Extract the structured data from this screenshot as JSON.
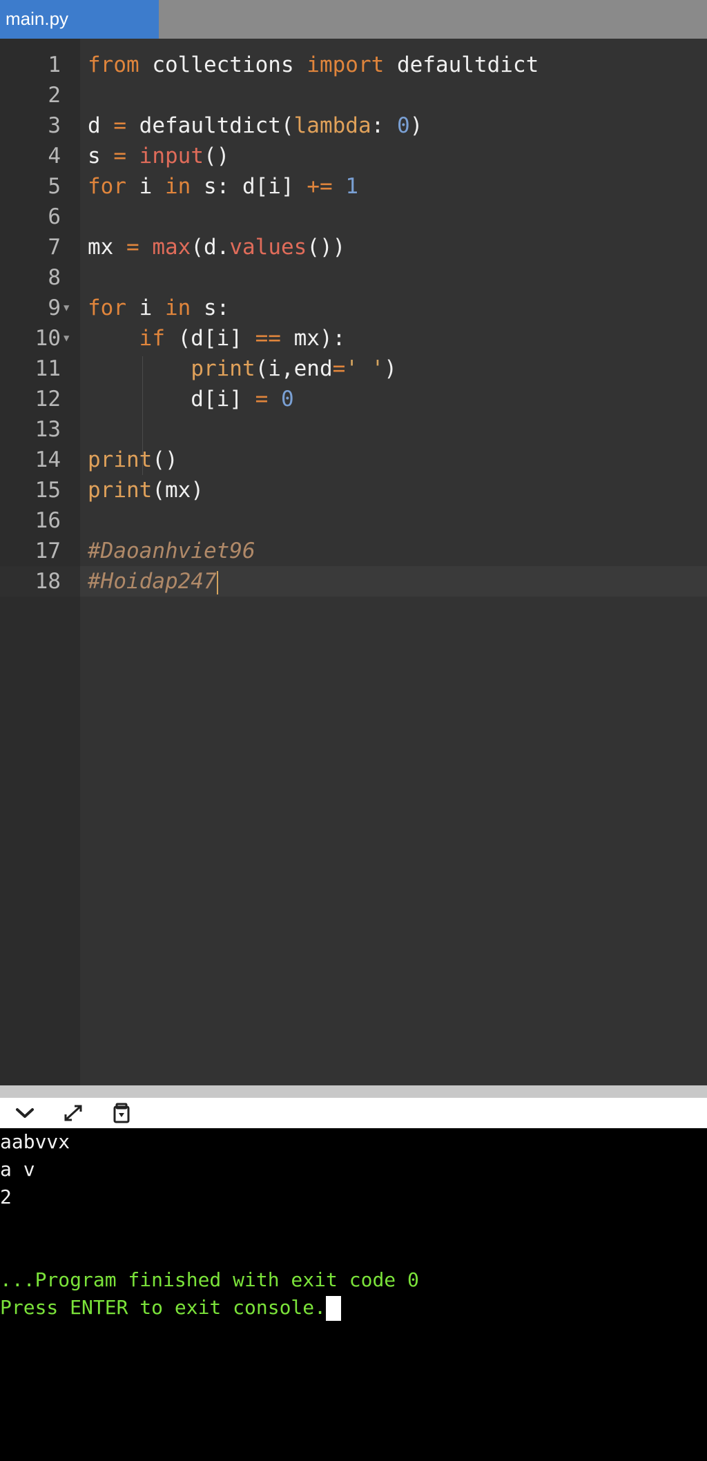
{
  "tab": {
    "label": "main.py"
  },
  "editor": {
    "lines": [
      {
        "n": "1"
      },
      {
        "n": "2"
      },
      {
        "n": "3"
      },
      {
        "n": "4"
      },
      {
        "n": "5"
      },
      {
        "n": "6"
      },
      {
        "n": "7"
      },
      {
        "n": "8"
      },
      {
        "n": "9"
      },
      {
        "n": "10"
      },
      {
        "n": "11"
      },
      {
        "n": "12"
      },
      {
        "n": "13"
      },
      {
        "n": "14"
      },
      {
        "n": "15"
      },
      {
        "n": "16"
      },
      {
        "n": "17"
      },
      {
        "n": "18"
      }
    ],
    "tokens": {
      "l1": [
        "from",
        " collections ",
        "import",
        " defaultdict"
      ],
      "l3": [
        "d ",
        "=",
        " defaultdict(",
        "lambda",
        ": ",
        "0",
        ")"
      ],
      "l4": [
        "s ",
        "=",
        " ",
        "input",
        "()"
      ],
      "l5": [
        "for",
        " i ",
        "in",
        " s: d[i] ",
        "+=",
        " ",
        "1"
      ],
      "l7": [
        "mx ",
        "=",
        " ",
        "max",
        "(d.",
        "values",
        "())"
      ],
      "l9": [
        "for",
        " i ",
        "in",
        " s:"
      ],
      "l10": [
        "    ",
        "if",
        " (d[i] ",
        "==",
        " mx):"
      ],
      "l11": [
        "        ",
        "print",
        "(i,end",
        "=",
        "' '",
        ")"
      ],
      "l12": [
        "        d[i] ",
        "=",
        " ",
        "0"
      ],
      "l14": [
        "print",
        "()"
      ],
      "l15": [
        "print",
        "(mx)"
      ],
      "l17": [
        "#Daoanhviet96"
      ],
      "l18": [
        "#Hoidap247"
      ]
    }
  },
  "console": {
    "lines": [
      "aabvvx",
      "a v",
      "2",
      "...Program finished with exit code 0",
      "Press ENTER to exit console."
    ]
  },
  "icons": {
    "collapse": "chevron-down-icon",
    "expand": "expand-arrows-icon",
    "copy": "copy-paste-icon"
  },
  "colors": {
    "tab_active": "#3d7ccc",
    "editor_bg": "#333333",
    "console_bg": "#000000",
    "console_status": "#7be33a"
  }
}
